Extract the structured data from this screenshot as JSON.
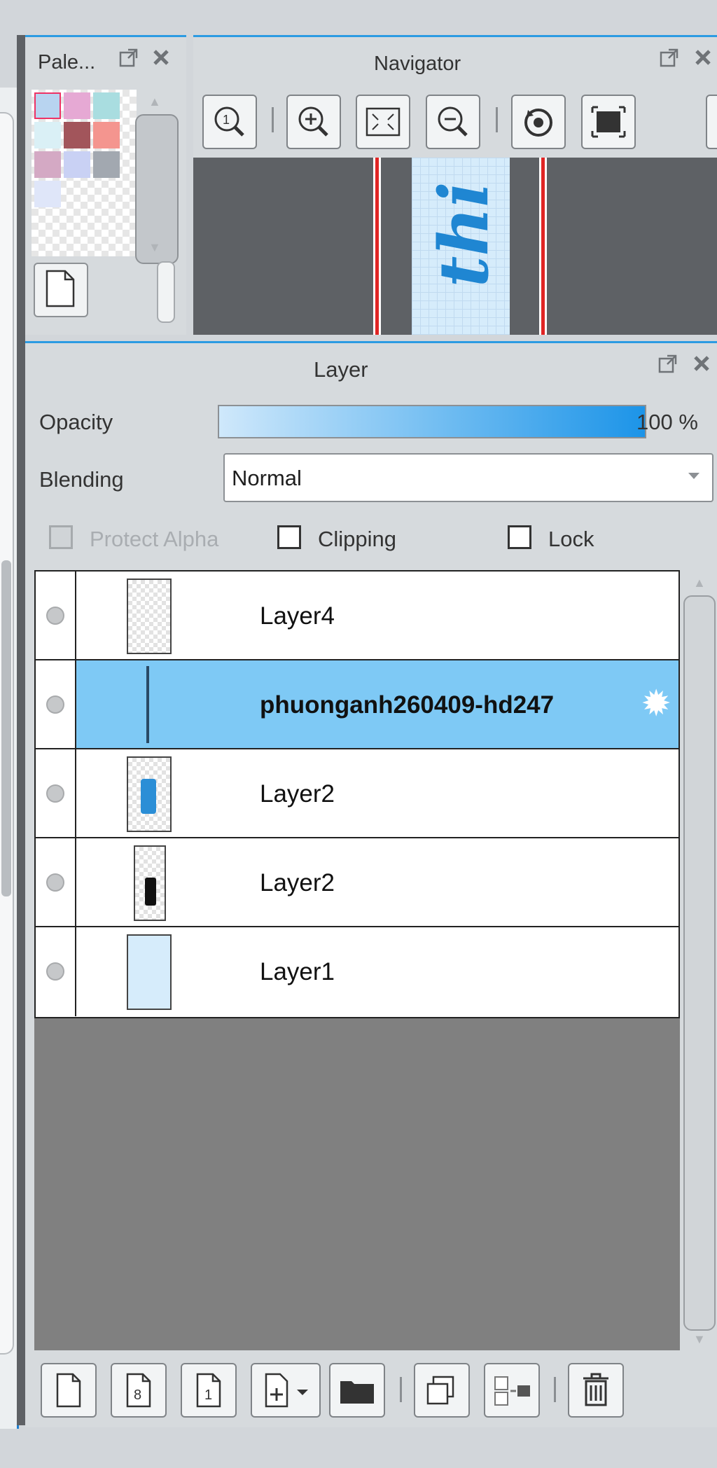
{
  "palette": {
    "title": "Pale...",
    "swatches": [
      "#b8d4f0",
      "#e6a9d4",
      "#a9dde0",
      "#daf0f6",
      "#a2555b",
      "#f4958f",
      "#d4a9c4",
      "#c9d1f4",
      "#a2a8b0",
      "#dfe6f9"
    ]
  },
  "navigator": {
    "title": "Navigator",
    "thumbnail_text": "thi"
  },
  "layer_panel": {
    "title": "Layer",
    "opacity_label": "Opacity",
    "opacity_value_text": "100 %",
    "opacity_fraction": 1.0,
    "blending_label": "Blending",
    "blending_value": "Normal",
    "protect_alpha_label": "Protect Alpha",
    "clipping_label": "Clipping",
    "lock_label": "Lock",
    "layers": [
      {
        "name": "Layer4",
        "selected": false
      },
      {
        "name": "phuonganh260409-hd247",
        "selected": true
      },
      {
        "name": "Layer2",
        "selected": false
      },
      {
        "name": "Layer2",
        "selected": false
      },
      {
        "name": "Layer1",
        "selected": false
      }
    ]
  },
  "colors": {
    "accent": "#2c9be2",
    "selected_row": "#7ec9f5",
    "canvas_gray": "#808080"
  }
}
